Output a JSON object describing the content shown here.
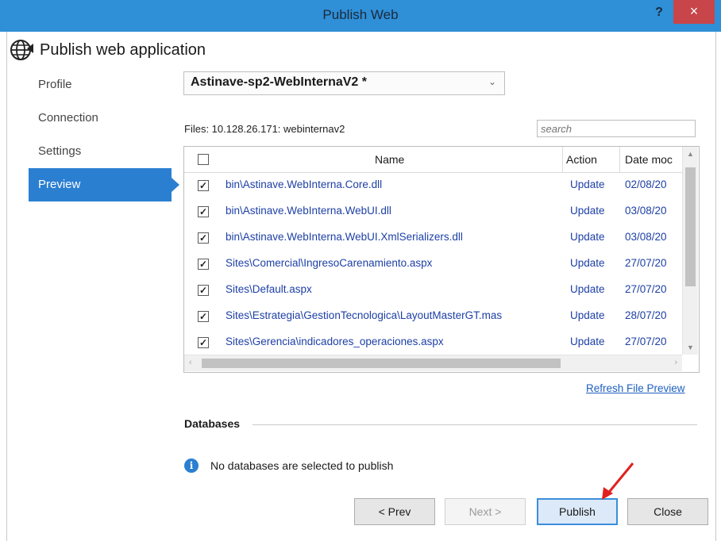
{
  "window": {
    "title": "Publish Web",
    "help_label": "?",
    "close_label": "×"
  },
  "header": {
    "title": "Publish web application",
    "icon": "globe-publish-icon"
  },
  "sidebar": {
    "items": [
      {
        "label": "Profile"
      },
      {
        "label": "Connection"
      },
      {
        "label": "Settings"
      },
      {
        "label": "Preview",
        "active": true
      }
    ]
  },
  "profile": {
    "selected": "Astinave-sp2-WebInternaV2 *"
  },
  "files": {
    "label": "Files:  10.128.26.171: webinternav2",
    "search_placeholder": "search",
    "columns": {
      "name": "Name",
      "action": "Action",
      "date": "Date moc"
    },
    "rows": [
      {
        "name": "bin\\Astinave.WebInterna.Core.dll",
        "action": "Update",
        "date": "02/08/20",
        "checked": true
      },
      {
        "name": "bin\\Astinave.WebInterna.WebUI.dll",
        "action": "Update",
        "date": "03/08/20",
        "checked": true
      },
      {
        "name": "bin\\Astinave.WebInterna.WebUI.XmlSerializers.dll",
        "action": "Update",
        "date": "03/08/20",
        "checked": true
      },
      {
        "name": "Sites\\Comercial\\IngresoCarenamiento.aspx",
        "action": "Update",
        "date": "27/07/20",
        "checked": true
      },
      {
        "name": "Sites\\Default.aspx",
        "action": "Update",
        "date": "27/07/20",
        "checked": true
      },
      {
        "name": "Sites\\Estrategia\\GestionTecnologica\\LayoutMasterGT.mas",
        "action": "Update",
        "date": "28/07/20",
        "checked": true
      },
      {
        "name": "Sites\\Gerencia\\indicadores_operaciones.aspx",
        "action": "Update",
        "date": "27/07/20",
        "checked": true
      }
    ],
    "refresh_label": "Refresh File Preview"
  },
  "databases": {
    "title": "Databases",
    "message": "No databases are selected to publish"
  },
  "buttons": {
    "prev": "< Prev",
    "next": "Next >",
    "publish": "Publish",
    "close": "Close"
  },
  "colors": {
    "titlebar": "#2f8fd7",
    "accent": "#2b7fd1",
    "close": "#c8454a",
    "annotation_arrow": "#e02020"
  }
}
